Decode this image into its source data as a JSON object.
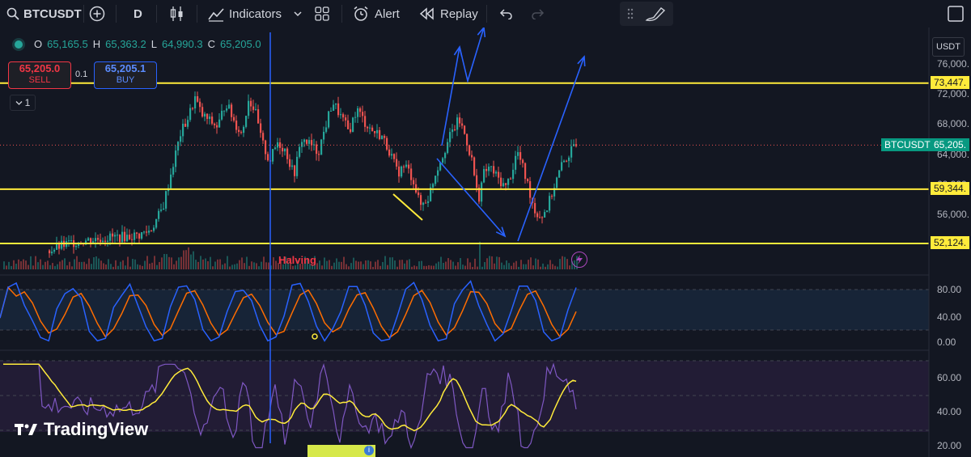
{
  "toolbar": {
    "symbol": "BTCUSDT",
    "interval": "D",
    "indicators": "Indicators",
    "alert": "Alert",
    "replay": "Replay"
  },
  "legend": {
    "o_label": "O",
    "o_value": "65,165.5",
    "h_label": "H",
    "h_value": "65,363.2",
    "l_label": "L",
    "l_value": "64,990.3",
    "c_label": "C",
    "c_value": "65,205.0"
  },
  "trade": {
    "sell_price": "65,205.0",
    "sell_label": "SELL",
    "buy_price": "65,205.1",
    "buy_label": "BUY",
    "spread": "0.1",
    "collapse": "1"
  },
  "price_axis": {
    "currency": "USDT",
    "ticks": [
      "76,000.",
      "72,000.",
      "68,000.",
      "64,000.",
      "60,000.",
      "56,000."
    ],
    "levels": [
      "73,447.",
      "59,344.",
      "52,124."
    ],
    "last_price": "65,205.",
    "last_symbol": "BTCUSDT"
  },
  "stoch_axis": {
    "ticks": [
      "80.00",
      "40.00",
      "0.00"
    ]
  },
  "rsi_axis": {
    "ticks": [
      "60.00",
      "40.00",
      "20.00"
    ]
  },
  "annotations": {
    "halving": "Halving"
  },
  "brand": "TradingView",
  "colors": {
    "bg": "#131722",
    "up": "#26a69a",
    "down": "#ef5350",
    "level": "#ffeb3b",
    "arrow": "#2962ff",
    "stoch_k": "#2962ff",
    "stoch_d": "#ff6d00",
    "rsi": "#7e57c2",
    "rsi_ma": "#ffeb3b",
    "halving_line": "#2962ff"
  },
  "chart_data": {
    "type": "candlestick",
    "interval": "D",
    "ylim": [
      50000,
      78000
    ],
    "last": 65205,
    "levels": [
      73447,
      59344,
      52124
    ],
    "close_path": [
      [
        60,
        51200
      ],
      [
        75,
        51800
      ],
      [
        90,
        52300
      ],
      [
        110,
        52600
      ],
      [
        130,
        52900
      ],
      [
        150,
        53000
      ],
      [
        170,
        53200
      ],
      [
        185,
        53900
      ],
      [
        200,
        56800
      ],
      [
        212,
        62300
      ],
      [
        222,
        66700
      ],
      [
        232,
        69000
      ],
      [
        240,
        71500
      ],
      [
        248,
        69200
      ],
      [
        258,
        68400
      ],
      [
        268,
        67600
      ],
      [
        278,
        71000
      ],
      [
        288,
        68400
      ],
      [
        298,
        66600
      ],
      [
        306,
        71400
      ],
      [
        314,
        69800
      ],
      [
        322,
        65800
      ],
      [
        332,
        63000
      ],
      [
        342,
        65600
      ],
      [
        352,
        64500
      ],
      [
        362,
        61200
      ],
      [
        372,
        66000
      ],
      [
        382,
        65300
      ],
      [
        392,
        64200
      ],
      [
        402,
        68000
      ],
      [
        410,
        71000
      ],
      [
        420,
        69000
      ],
      [
        430,
        67000
      ],
      [
        440,
        70000
      ],
      [
        450,
        68200
      ],
      [
        460,
        67000
      ],
      [
        470,
        66500
      ],
      [
        480,
        64500
      ],
      [
        490,
        61500
      ],
      [
        500,
        62500
      ],
      [
        510,
        60500
      ],
      [
        518,
        57100
      ],
      [
        528,
        58200
      ],
      [
        538,
        61800
      ],
      [
        546,
        64000
      ],
      [
        556,
        66600
      ],
      [
        566,
        68600
      ],
      [
        574,
        66400
      ],
      [
        582,
        63200
      ],
      [
        590,
        57800
      ],
      [
        596,
        61300
      ],
      [
        604,
        62300
      ],
      [
        614,
        60800
      ],
      [
        624,
        59600
      ],
      [
        632,
        61800
      ],
      [
        638,
        64500
      ],
      [
        644,
        62500
      ],
      [
        652,
        59600
      ],
      [
        660,
        56400
      ],
      [
        668,
        55700
      ],
      [
        676,
        57100
      ],
      [
        684,
        59800
      ],
      [
        694,
        62700
      ],
      [
        704,
        64300
      ],
      [
        712,
        65200
      ]
    ],
    "stoch_points": 72,
    "rsi_range": [
      20,
      80
    ]
  }
}
